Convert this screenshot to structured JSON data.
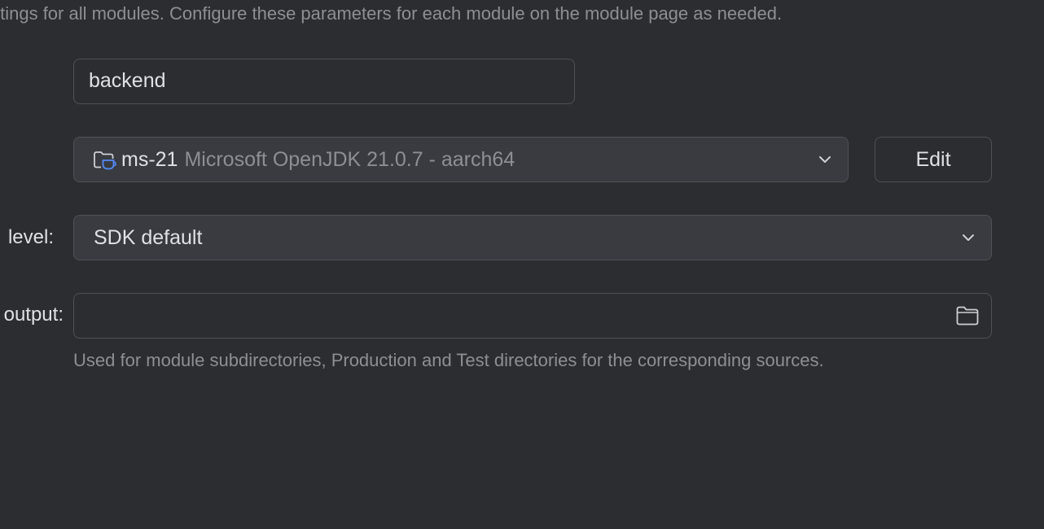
{
  "description": "ttings for all modules. Configure these parameters for each module on the module page as needed.",
  "name_field": {
    "value": "backend"
  },
  "sdk": {
    "name": "ms-21",
    "detail": "Microsoft OpenJDK 21.0.7 - aarch64",
    "edit_label": "Edit",
    "icon": "module-sdk-folder-icon"
  },
  "language_level": {
    "label": "level:",
    "value": "SDK default"
  },
  "compiler_output": {
    "label": "output:",
    "value": "",
    "icon": "folder-icon",
    "hint": "Used for module subdirectories, Production and Test directories for the corresponding sources."
  },
  "colors": {
    "background": "#2b2d30",
    "field_border": "#4e5157",
    "combo_background": "#393b40",
    "text": "#dfe1e5",
    "muted_text": "#8c8f94",
    "sdk_icon_accent": "#548af7"
  }
}
